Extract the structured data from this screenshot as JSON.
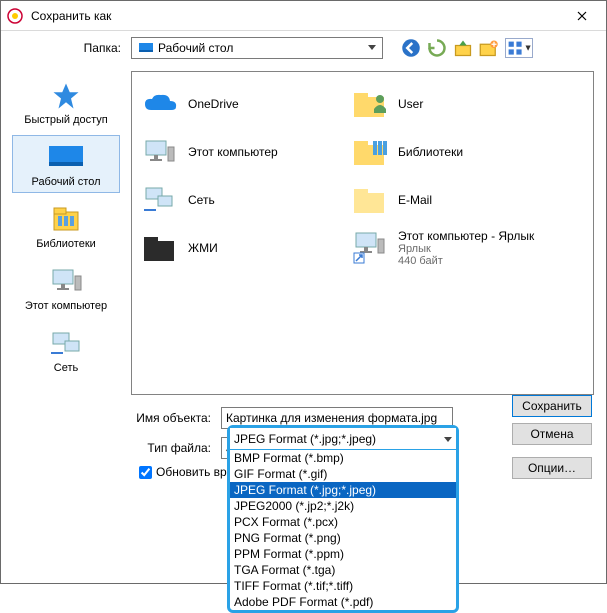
{
  "title": "Сохранить как",
  "folder_label": "Папка:",
  "folder_value": "Рабочий стол",
  "nav": {
    "back": "back",
    "recent": "recent",
    "up": "up",
    "newfolder": "newfolder",
    "views": "views"
  },
  "places": [
    {
      "id": "quick",
      "label": "Быстрый доступ"
    },
    {
      "id": "desktop",
      "label": "Рабочий стол"
    },
    {
      "id": "libs",
      "label": "Библиотеки"
    },
    {
      "id": "pc",
      "label": "Этот компьютер"
    },
    {
      "id": "net",
      "label": "Сеть"
    }
  ],
  "items": [
    {
      "id": "onedrive",
      "name": "OneDrive"
    },
    {
      "id": "user",
      "name": "User"
    },
    {
      "id": "thispc",
      "name": "Этот компьютер"
    },
    {
      "id": "libs",
      "name": "Библиотеки"
    },
    {
      "id": "net",
      "name": "Сеть"
    },
    {
      "id": "email",
      "name": "E-Mail"
    },
    {
      "id": "zhmi",
      "name": "ЖМИ"
    },
    {
      "id": "pcshort",
      "name": "Этот компьютер - Ярлык",
      "sub1": "Ярлык",
      "sub2": "440 байт"
    }
  ],
  "filename_label": "Имя объекта:",
  "filename_value": "Картинка для изменения формата.jpg",
  "filetype_label": "Тип файла:",
  "filetype_value": "JPEG Format (*.jpg;*.jpeg)",
  "checkbox_label": "Обновить время ф",
  "btn_save": "Сохранить",
  "btn_cancel": "Отмена",
  "btn_options": "Опции…",
  "formats": [
    "BMP Format (*.bmp)",
    "GIF Format (*.gif)",
    "JPEG Format (*.jpg;*.jpeg)",
    "JPEG2000 (*.jp2;*.j2k)",
    "PCX Format (*.pcx)",
    "PNG Format (*.png)",
    "PPM Format (*.ppm)",
    "TGA Format (*.tga)",
    "TIFF Format (*.tif;*.tiff)",
    "Adobe PDF Format (*.pdf)"
  ],
  "formats_highlight": 2
}
